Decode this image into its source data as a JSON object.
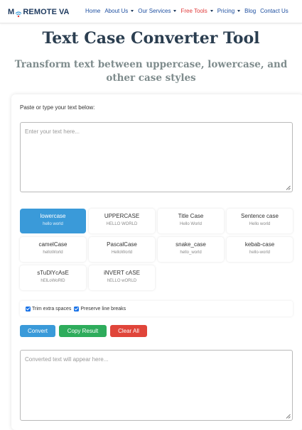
{
  "header": {
    "logo": {
      "m": "M",
      "rest": "REMOTE",
      "va": "VA"
    },
    "nav": [
      {
        "label": "Home",
        "dropdown": false,
        "active": false
      },
      {
        "label": "About Us",
        "dropdown": true,
        "active": false
      },
      {
        "label": "Our Services",
        "dropdown": true,
        "active": false
      },
      {
        "label": "Free Tools",
        "dropdown": true,
        "active": true
      },
      {
        "label": "Pricing",
        "dropdown": true,
        "active": false
      },
      {
        "label": "Blog",
        "dropdown": false,
        "active": false
      },
      {
        "label": "Contact Us",
        "dropdown": false,
        "active": false
      }
    ]
  },
  "hero": {
    "title": "Text Case Converter Tool",
    "subtitle": "Transform text between uppercase, lowercase, and other case styles"
  },
  "input": {
    "label": "Paste or type your text below:",
    "placeholder": "Enter your text here...",
    "value": ""
  },
  "cases": [
    {
      "name": "lowercase",
      "example": "hello world",
      "selected": true
    },
    {
      "name": "UPPERCASE",
      "example": "HELLO WORLD",
      "selected": false
    },
    {
      "name": "Title Case",
      "example": "Hello World",
      "selected": false
    },
    {
      "name": "Sentence case",
      "example": "Hello world",
      "selected": false
    },
    {
      "name": "camelCase",
      "example": "helloWorld",
      "selected": false
    },
    {
      "name": "PascalCase",
      "example": "HelloWorld",
      "selected": false
    },
    {
      "name": "snake_case",
      "example": "hello_world",
      "selected": false
    },
    {
      "name": "kebab-case",
      "example": "hello-world",
      "selected": false
    },
    {
      "name": "sTuDlYcAsE",
      "example": "hElLoWoRlD",
      "selected": false
    },
    {
      "name": "iNVERT cASE",
      "example": "hELLO wORLD",
      "selected": false
    }
  ],
  "options": [
    {
      "label": "Trim extra spaces",
      "checked": true
    },
    {
      "label": "Preserve line breaks",
      "checked": true
    }
  ],
  "actions": {
    "convert": "Convert",
    "copy": "Copy Result",
    "clear": "Clear All"
  },
  "output": {
    "placeholder": "Converted text will appear here...",
    "value": ""
  },
  "colors": {
    "accent": "#3a9ad9",
    "copy": "#2eac5c",
    "clear": "#e0453a",
    "nav_link": "#1e4fa0",
    "nav_active": "#e03a3a",
    "title": "#2b3e50",
    "subtitle": "#7f8c8d"
  }
}
